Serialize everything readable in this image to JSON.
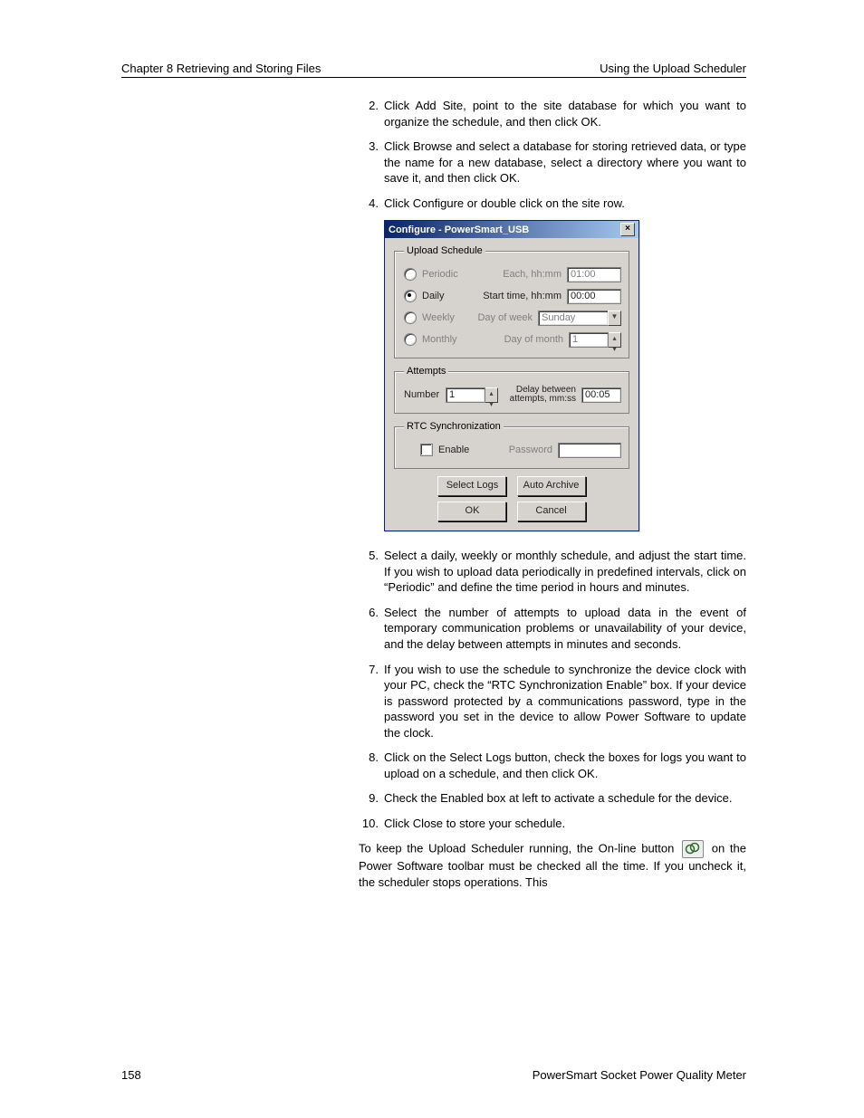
{
  "header": {
    "left": "Chapter 8 Retrieving and Storing Files",
    "right": "Using the Upload Scheduler"
  },
  "steps": [
    {
      "n": "2.",
      "t": "Click Add Site, point to the site database for which you want to organize the schedule, and then click OK."
    },
    {
      "n": "3.",
      "t": "Click Browse and select a database for storing retrieved data, or type the name for a new database, select a directory where you want to save it, and then click OK."
    },
    {
      "n": "4.",
      "t": "Click Configure or double click on the site row."
    }
  ],
  "dialog": {
    "title": "Configure - PowerSmart_USB",
    "close_glyph": "×",
    "groups": {
      "schedule": {
        "legend": "Upload Schedule",
        "periodic": {
          "label": "Periodic",
          "mid": "Each, hh:mm",
          "value": "01:00",
          "selected": false,
          "enabled": false
        },
        "daily": {
          "label": "Daily",
          "mid": "Start time, hh:mm",
          "value": "00:00",
          "selected": true,
          "enabled": true
        },
        "weekly": {
          "label": "Weekly",
          "mid": "Day of week",
          "value": "Sunday",
          "selected": false,
          "enabled": false
        },
        "monthly": {
          "label": "Monthly",
          "mid": "Day of month",
          "value": "1",
          "selected": false,
          "enabled": false
        }
      },
      "attempts": {
        "legend": "Attempts",
        "number_label": "Number",
        "number_value": "1",
        "delay_label": "Delay between attempts, mm:ss",
        "delay_value": "00:05"
      },
      "rtc": {
        "legend": "RTC Synchronization",
        "enable_label": "Enable",
        "password_label": "Password",
        "password_value": ""
      }
    },
    "buttons": {
      "select_logs": "Select Logs",
      "auto_archive": "Auto Archive",
      "ok": "OK",
      "cancel": "Cancel"
    }
  },
  "steps2": [
    {
      "n": "5.",
      "t": "Select a daily, weekly or monthly schedule, and adjust the start time. If you wish to upload data periodically in predefined intervals, click on “Periodic” and define the time period in hours and minutes."
    },
    {
      "n": "6.",
      "t": "Select the number of attempts to upload data in the event of temporary communication problems or unavailability of your device, and the delay between attempts in minutes and seconds."
    },
    {
      "n": "7.",
      "t": "If you wish to use the schedule to synchronize the device clock with your PC, check the “RTC Synchronization Enable” box. If your device is password protected by a communications password, type in the password you set in the device to allow Power Software to update the clock."
    },
    {
      "n": "8.",
      "t": "Click on the Select Logs button, check the boxes for logs you want to upload on a schedule, and then click OK."
    },
    {
      "n": "9.",
      "t": "Check the Enabled box at left to activate a schedule for the device."
    },
    {
      "n": "10.",
      "t": "Click Close to store your schedule."
    }
  ],
  "trailing": {
    "part1": "To keep the Upload Scheduler running, the On-line button ",
    "part2": " on the Power Software toolbar must be checked all the time. If you uncheck it, the scheduler stops operations. This"
  },
  "footer": {
    "page": "158",
    "title": "PowerSmart Socket Power Quality Meter"
  }
}
